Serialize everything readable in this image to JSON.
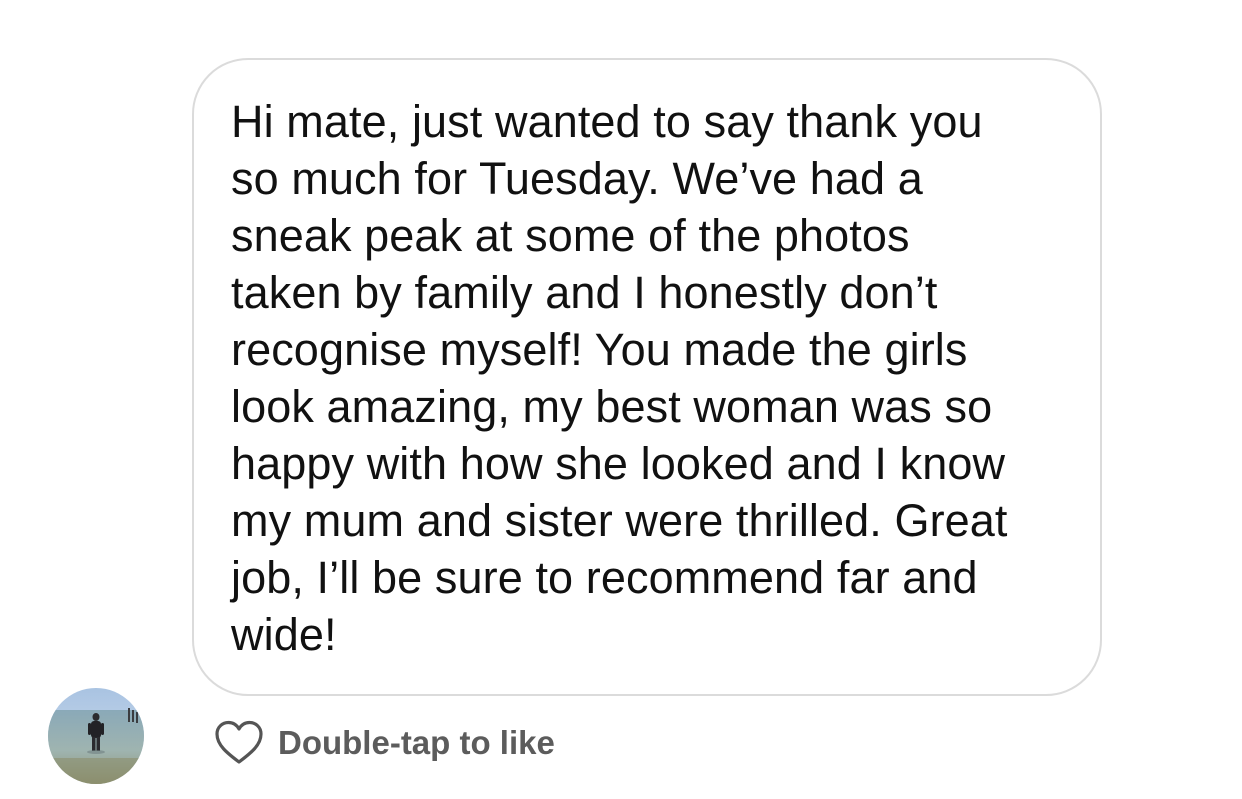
{
  "message": {
    "lines": [
      "Hi mate, just wanted to say thank you",
      "so much for Tuesday. We’ve had a",
      "sneak peak at some of the photos",
      "taken by family and I honestly don’t",
      "recognise myself! You made the girls",
      "look amazing, my best woman was so",
      "happy with how she looked and I know",
      "my mum and sister were thrilled. Great",
      "job, I’ll be sure to recommend far and",
      "wide!"
    ]
  },
  "reaction": {
    "icon": "heart-outline-icon",
    "label": "Double-tap to like"
  },
  "sender": {
    "avatar": "sender-avatar"
  },
  "colors": {
    "bubble_border": "#dbdbdb",
    "text": "#111111",
    "secondary_text": "#5c5c5c"
  }
}
